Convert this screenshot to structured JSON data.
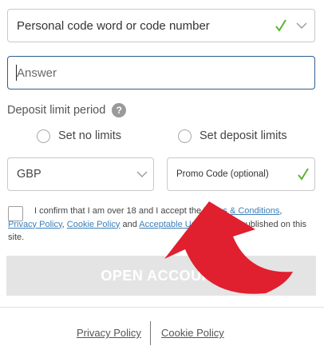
{
  "security": {
    "question_label": "Personal code word or code number",
    "answer_placeholder": "Answer"
  },
  "deposit_limit": {
    "title": "Deposit limit period",
    "help_glyph": "?",
    "options": [
      "Set no limits",
      "Set deposit limits"
    ]
  },
  "currency": {
    "value": "GBP"
  },
  "promo": {
    "label": "Promo Code (optional)"
  },
  "terms": {
    "text_1": "I confirm that I am over 18 and I accept the ",
    "link_terms": "Terms & Conditions",
    "sep_1": ", ",
    "link_privacy": "Privacy Policy",
    "sep_2": ", ",
    "link_cookie": "Cookie Policy",
    "text_and": " and ",
    "link_acceptable_use": "Acceptable Use Policy",
    "text_2": " as published on this site."
  },
  "submit": {
    "label": "OPEN ACCOUNT"
  },
  "footer": {
    "privacy": "Privacy Policy",
    "cookie": "Cookie Policy"
  },
  "colors": {
    "valid_check": "#5ab52e",
    "answer_border": "#2f5e8d",
    "link": "#3d7fb8",
    "button_disabled": "#e4e4e4",
    "overlay_arrow": "#e0202e"
  },
  "icons": {
    "valid": "check-icon",
    "dropdown": "chevron-down-icon",
    "help": "question-mark-icon",
    "overlay": "red-curved-arrow"
  }
}
